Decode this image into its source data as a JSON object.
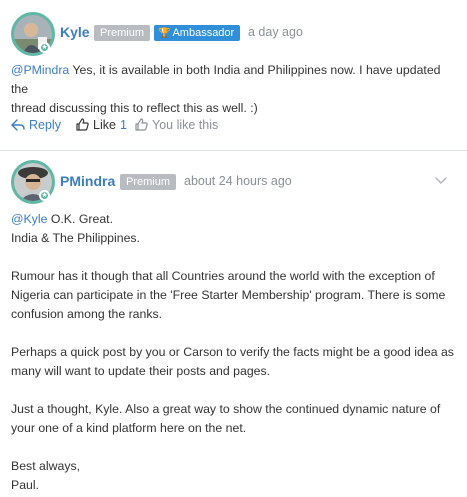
{
  "posts": [
    {
      "author": "Kyle",
      "premium_badge": "Premium",
      "ambassador_badge": "Ambassador",
      "timestamp": "a day ago",
      "mention": "@PMindra",
      "body_line1_rest": " Yes, it is available in both India and Philippines now. I have updated the",
      "body_line2": "thread discussing this to reflect this as well. :)",
      "actions": {
        "reply_label": "Reply",
        "like_label": "Like",
        "like_count": "1",
        "you_like_label": "You like this"
      }
    },
    {
      "author": "PMindra",
      "premium_badge": "Premium",
      "timestamp": "about 24 hours ago",
      "mention": "@Kyle",
      "paragraphs": [
        [
          " O.K. Great.",
          "India & The Philippines."
        ],
        [
          "Rumour has it though that all Countries around the world with the exception of",
          "Nigeria can participate in the 'Free Starter Membership' program. There is some",
          "confusion among the ranks."
        ],
        [
          "Perhaps a quick post by you or Carson to verify the facts might be a good idea as",
          "many will want to update their posts and pages."
        ],
        [
          "Just a thought, Kyle. Also a great way to show the continued dynamic nature of",
          "your one of a kind platform here on the net."
        ],
        [
          "Best always,",
          "Paul."
        ]
      ]
    }
  ],
  "colors": {
    "accent_link": "#3b7dbf",
    "avatar_ring": "#5fb8a6",
    "premium_badge": "#b8bcc0",
    "ambassador_badge": "#2f8fd8",
    "muted_text": "#8a9096",
    "divider": "#e2e5e8"
  },
  "icons": [
    "reply-arrow-icon",
    "thumbs-up-icon",
    "trophy-icon",
    "chevron-down-icon",
    "star-icon"
  ]
}
